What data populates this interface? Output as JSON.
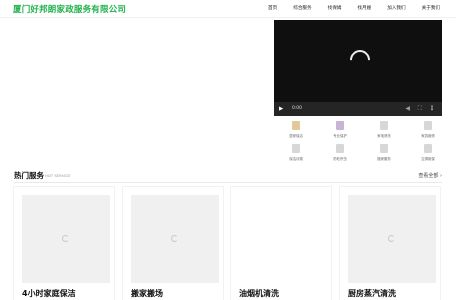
{
  "header": {
    "brand": "厦门好邦朗家政服务有限公司",
    "nav": [
      "首页",
      "综合服务",
      "找保姆",
      "找月嫂",
      "加入我们",
      "关于我们"
    ]
  },
  "video": {
    "time": "0:00",
    "play_icon": "play-icon",
    "volume_icon": "volume-icon",
    "fullscreen_icon": "fullscreen-icon",
    "more_icon": "more-options-icon"
  },
  "quick_links": [
    {
      "label": "居家保洁",
      "icon": "cleaning-icon"
    },
    {
      "label": "专业保护",
      "icon": "protection-icon"
    },
    {
      "label": "家电清洗",
      "icon": "appliance-icon"
    },
    {
      "label": "家具维修",
      "icon": "repair-icon"
    },
    {
      "label": "保洁月嫂",
      "icon": "nanny-icon"
    },
    {
      "label": "防蛀杀虫",
      "icon": "pest-icon"
    },
    {
      "label": "搬家服务",
      "icon": "moving-icon"
    },
    {
      "label": "空调维保",
      "icon": "aircon-icon"
    }
  ],
  "services": {
    "title": "热门服务",
    "subtitle": "HOT SERVICE",
    "view_all": "查看全部 ›",
    "cards": [
      {
        "title": "4小时家庭保洁"
      },
      {
        "title": "搬家搬场"
      },
      {
        "title": "油烟机清洗"
      },
      {
        "title": "厨房蒸汽清洗"
      }
    ]
  }
}
